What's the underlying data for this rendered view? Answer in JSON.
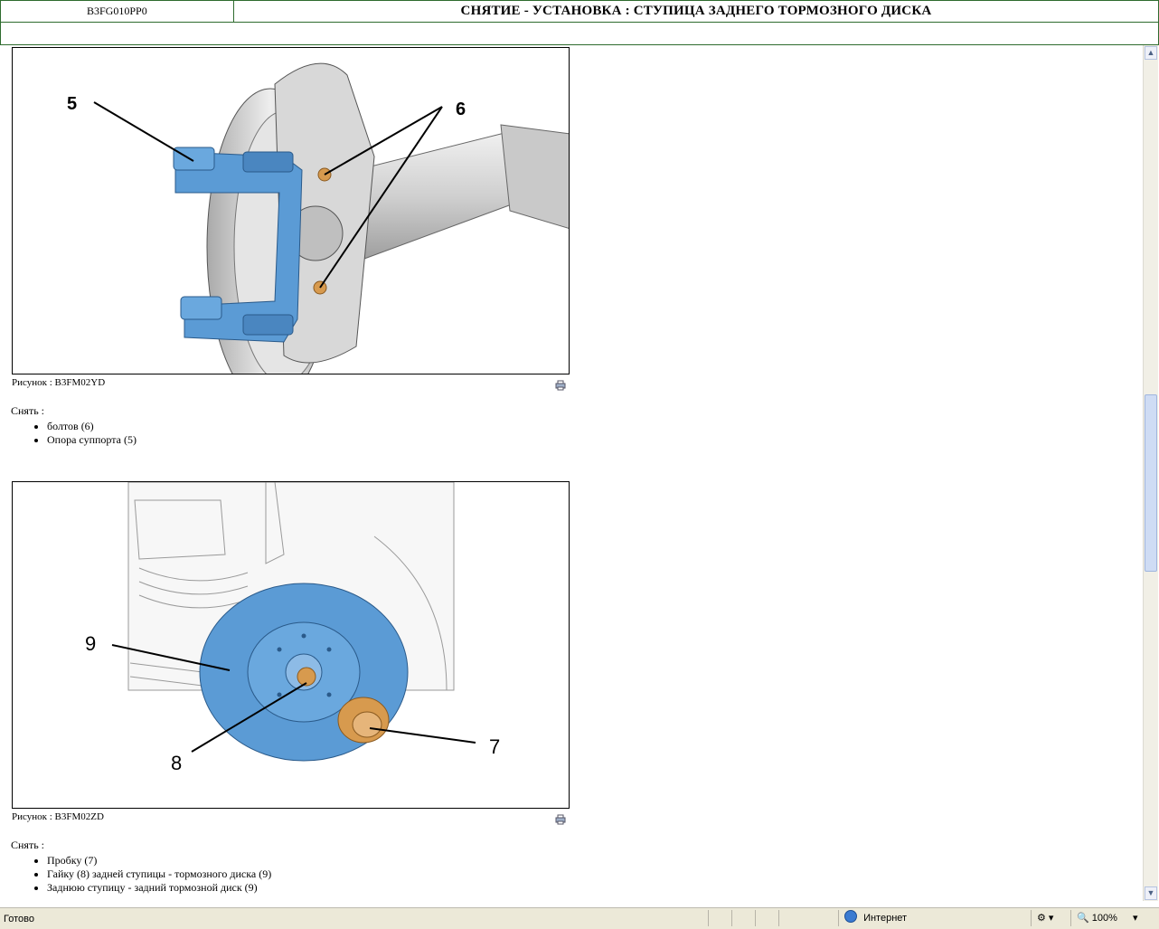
{
  "header": {
    "doc_code": "B3FG010PP0",
    "title": "СНЯТИЕ - УСТАНОВКА : СТУПИЦА ЗАДНЕГО ТОРМОЗНОГО ДИСКА"
  },
  "figure1": {
    "caption": "Рисунок : B3FM02YD",
    "callouts": {
      "support": "5",
      "bolts": "6"
    }
  },
  "step1": {
    "label": "Снять :",
    "items": [
      "болтов (6)",
      "Опора суппорта (5)"
    ]
  },
  "figure2": {
    "caption": "Рисунок : B3FM02ZD",
    "callouts": {
      "disc": "9",
      "nut": "8",
      "cap": "7"
    }
  },
  "step2": {
    "label": "Снять :",
    "items": [
      "Пробку (7)",
      "Гайку (8) задней ступицы - тормозного диска (9)",
      "Заднюю ступицу - задний тормозной диск (9)"
    ]
  },
  "statusbar": {
    "status_text": "Готово",
    "zone": "Интернет",
    "zoom": "100%"
  },
  "colors": {
    "header_border": "#2e6b2e",
    "part_blue": "#5b9bd5",
    "part_copper": "#d79a4e"
  },
  "icons": [
    "print-icon",
    "globe-icon",
    "zoom-icon",
    "scroll-up-icon",
    "scroll-down-icon"
  ]
}
